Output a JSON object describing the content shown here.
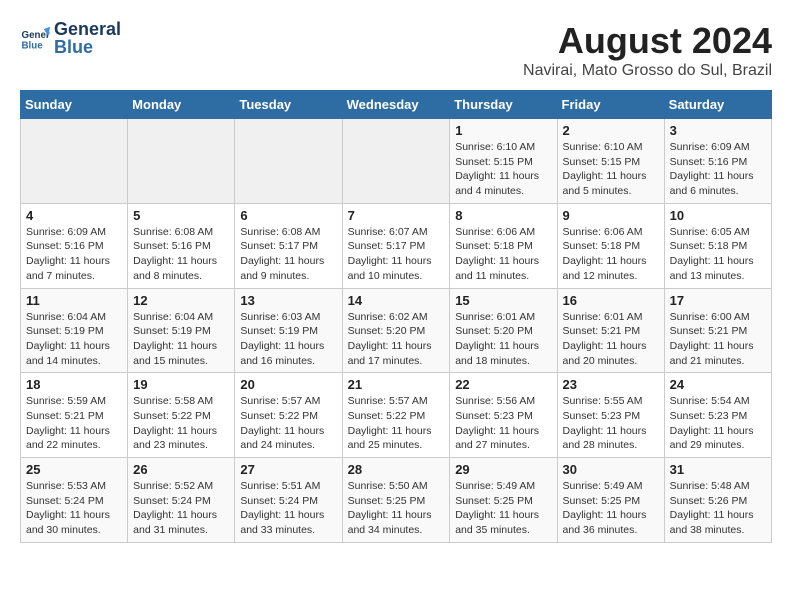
{
  "header": {
    "logo_general": "General",
    "logo_blue": "Blue",
    "title": "August 2024",
    "subtitle": "Navirai, Mato Grosso do Sul, Brazil"
  },
  "calendar": {
    "headers": [
      "Sunday",
      "Monday",
      "Tuesday",
      "Wednesday",
      "Thursday",
      "Friday",
      "Saturday"
    ],
    "weeks": [
      [
        {
          "num": "",
          "detail": ""
        },
        {
          "num": "",
          "detail": ""
        },
        {
          "num": "",
          "detail": ""
        },
        {
          "num": "",
          "detail": ""
        },
        {
          "num": "1",
          "detail": "Sunrise: 6:10 AM\nSunset: 5:15 PM\nDaylight: 11 hours\nand 4 minutes."
        },
        {
          "num": "2",
          "detail": "Sunrise: 6:10 AM\nSunset: 5:15 PM\nDaylight: 11 hours\nand 5 minutes."
        },
        {
          "num": "3",
          "detail": "Sunrise: 6:09 AM\nSunset: 5:16 PM\nDaylight: 11 hours\nand 6 minutes."
        }
      ],
      [
        {
          "num": "4",
          "detail": "Sunrise: 6:09 AM\nSunset: 5:16 PM\nDaylight: 11 hours\nand 7 minutes."
        },
        {
          "num": "5",
          "detail": "Sunrise: 6:08 AM\nSunset: 5:16 PM\nDaylight: 11 hours\nand 8 minutes."
        },
        {
          "num": "6",
          "detail": "Sunrise: 6:08 AM\nSunset: 5:17 PM\nDaylight: 11 hours\nand 9 minutes."
        },
        {
          "num": "7",
          "detail": "Sunrise: 6:07 AM\nSunset: 5:17 PM\nDaylight: 11 hours\nand 10 minutes."
        },
        {
          "num": "8",
          "detail": "Sunrise: 6:06 AM\nSunset: 5:18 PM\nDaylight: 11 hours\nand 11 minutes."
        },
        {
          "num": "9",
          "detail": "Sunrise: 6:06 AM\nSunset: 5:18 PM\nDaylight: 11 hours\nand 12 minutes."
        },
        {
          "num": "10",
          "detail": "Sunrise: 6:05 AM\nSunset: 5:18 PM\nDaylight: 11 hours\nand 13 minutes."
        }
      ],
      [
        {
          "num": "11",
          "detail": "Sunrise: 6:04 AM\nSunset: 5:19 PM\nDaylight: 11 hours\nand 14 minutes."
        },
        {
          "num": "12",
          "detail": "Sunrise: 6:04 AM\nSunset: 5:19 PM\nDaylight: 11 hours\nand 15 minutes."
        },
        {
          "num": "13",
          "detail": "Sunrise: 6:03 AM\nSunset: 5:19 PM\nDaylight: 11 hours\nand 16 minutes."
        },
        {
          "num": "14",
          "detail": "Sunrise: 6:02 AM\nSunset: 5:20 PM\nDaylight: 11 hours\nand 17 minutes."
        },
        {
          "num": "15",
          "detail": "Sunrise: 6:01 AM\nSunset: 5:20 PM\nDaylight: 11 hours\nand 18 minutes."
        },
        {
          "num": "16",
          "detail": "Sunrise: 6:01 AM\nSunset: 5:21 PM\nDaylight: 11 hours\nand 20 minutes."
        },
        {
          "num": "17",
          "detail": "Sunrise: 6:00 AM\nSunset: 5:21 PM\nDaylight: 11 hours\nand 21 minutes."
        }
      ],
      [
        {
          "num": "18",
          "detail": "Sunrise: 5:59 AM\nSunset: 5:21 PM\nDaylight: 11 hours\nand 22 minutes."
        },
        {
          "num": "19",
          "detail": "Sunrise: 5:58 AM\nSunset: 5:22 PM\nDaylight: 11 hours\nand 23 minutes."
        },
        {
          "num": "20",
          "detail": "Sunrise: 5:57 AM\nSunset: 5:22 PM\nDaylight: 11 hours\nand 24 minutes."
        },
        {
          "num": "21",
          "detail": "Sunrise: 5:57 AM\nSunset: 5:22 PM\nDaylight: 11 hours\nand 25 minutes."
        },
        {
          "num": "22",
          "detail": "Sunrise: 5:56 AM\nSunset: 5:23 PM\nDaylight: 11 hours\nand 27 minutes."
        },
        {
          "num": "23",
          "detail": "Sunrise: 5:55 AM\nSunset: 5:23 PM\nDaylight: 11 hours\nand 28 minutes."
        },
        {
          "num": "24",
          "detail": "Sunrise: 5:54 AM\nSunset: 5:23 PM\nDaylight: 11 hours\nand 29 minutes."
        }
      ],
      [
        {
          "num": "25",
          "detail": "Sunrise: 5:53 AM\nSunset: 5:24 PM\nDaylight: 11 hours\nand 30 minutes."
        },
        {
          "num": "26",
          "detail": "Sunrise: 5:52 AM\nSunset: 5:24 PM\nDaylight: 11 hours\nand 31 minutes."
        },
        {
          "num": "27",
          "detail": "Sunrise: 5:51 AM\nSunset: 5:24 PM\nDaylight: 11 hours\nand 33 minutes."
        },
        {
          "num": "28",
          "detail": "Sunrise: 5:50 AM\nSunset: 5:25 PM\nDaylight: 11 hours\nand 34 minutes."
        },
        {
          "num": "29",
          "detail": "Sunrise: 5:49 AM\nSunset: 5:25 PM\nDaylight: 11 hours\nand 35 minutes."
        },
        {
          "num": "30",
          "detail": "Sunrise: 5:49 AM\nSunset: 5:25 PM\nDaylight: 11 hours\nand 36 minutes."
        },
        {
          "num": "31",
          "detail": "Sunrise: 5:48 AM\nSunset: 5:26 PM\nDaylight: 11 hours\nand 38 minutes."
        }
      ]
    ]
  }
}
